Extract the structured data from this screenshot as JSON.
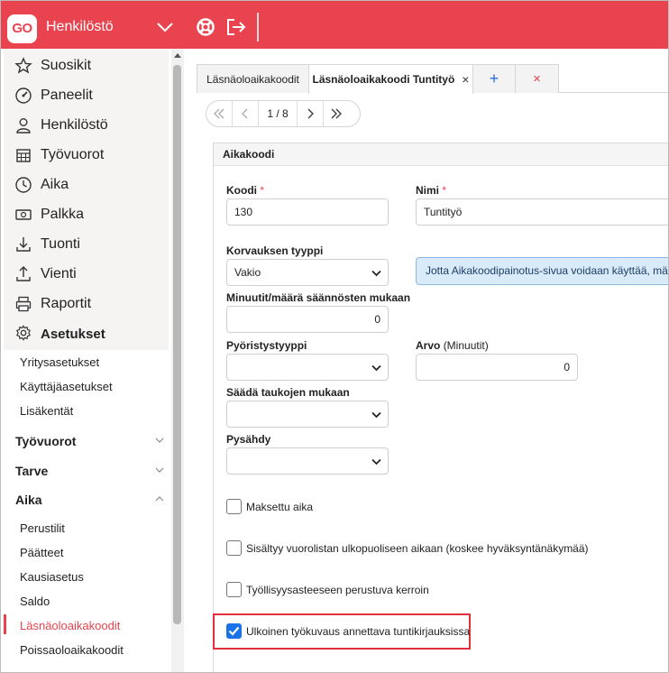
{
  "header": {
    "logo_text": "GO",
    "app_title": "Henkilöstö",
    "accent": "#e8434e"
  },
  "sidebar": {
    "items": [
      {
        "label": "Suosikit",
        "icon": "star-icon"
      },
      {
        "label": "Paneelit",
        "icon": "dashboard-icon"
      },
      {
        "label": "Henkilöstö",
        "icon": "person-icon"
      },
      {
        "label": "Työvuorot",
        "icon": "calendar-icon"
      },
      {
        "label": "Aika",
        "icon": "clock-icon"
      },
      {
        "label": "Palkka",
        "icon": "money-icon"
      },
      {
        "label": "Tuonti",
        "icon": "download-icon"
      },
      {
        "label": "Vienti",
        "icon": "upload-icon"
      },
      {
        "label": "Raportit",
        "icon": "printer-icon"
      }
    ],
    "settings_label": "Asetukset",
    "settings_sub": [
      "Yritysasetukset",
      "Käyttäjäasetukset",
      "Lisäkentät"
    ],
    "groups": {
      "tyovuorot": "Työvuorot",
      "tarve": "Tarve",
      "aika": "Aika"
    },
    "aika_sub": [
      "Perustilit",
      "Päätteet",
      "Kausiasetus",
      "Saldo",
      "Läsnäoloaikakoodit",
      "Poissaoloaikakoodit"
    ]
  },
  "tabs": {
    "tab1": "Läsnäoloaikakoodit",
    "tab2": "Läsnäoloaikakoodi Tuntityö",
    "close_glyph": "×",
    "add_glyph": "+",
    "close_all_glyph": "×"
  },
  "pager": {
    "page_text": "1 / 8",
    "current": 1,
    "total": 8
  },
  "form": {
    "panel_title": "Aikakoodi",
    "koodi_label": "Koodi",
    "koodi_value": "130",
    "nimi_label": "Nimi",
    "nimi_value": "Tuntityö",
    "required_mark": "*",
    "korvauksen_label": "Korvauksen tyyppi",
    "korvauksen_value": "Vakio",
    "info_text": "Jotta Aikakoodipainotus-sivua voidaan käyttää, määritä",
    "minuutit_label": "Minuutit/määrä säännösten mukaan",
    "minuutit_value": "0",
    "pyoristys_label": "Pyöristystyyppi",
    "pyoristys_value": "",
    "arvo_label": "Arvo",
    "arvo_unit": "(Minuutit)",
    "arvo_value": "0",
    "saada_label": "Säädä taukojen mukaan",
    "saada_value": "",
    "pysahdy_label": "Pysähdy",
    "pysahdy_value": ""
  },
  "checkboxes": [
    {
      "label": "Maksettu aika",
      "checked": false
    },
    {
      "label": "Sisältyy vuorolistan ulkopuoliseen aikaan (koskee hyväksyntänäkymää)",
      "checked": false
    },
    {
      "label": "Työllisyysasteeseen perustuva kerroin",
      "checked": false
    },
    {
      "label": "Ulkoinen työkuvaus annettava tuntikirjauksissa",
      "checked": true
    }
  ]
}
